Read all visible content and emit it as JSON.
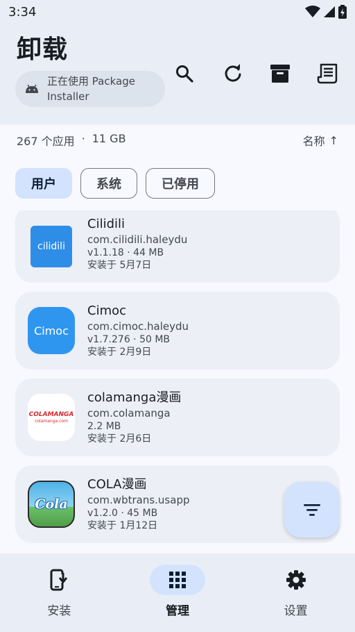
{
  "status_bar": {
    "time": "3:34"
  },
  "header": {
    "title": "卸载",
    "installer_chip": "正在使用 Package Installer"
  },
  "toolbar": {
    "icons": [
      "search-icon",
      "refresh-icon",
      "archive-icon",
      "log-icon"
    ]
  },
  "summary": {
    "app_count": "267 个应用",
    "separator": "·",
    "total_size": "11 GB",
    "sort_label": "名称",
    "sort_arrow": "↑"
  },
  "filters": [
    {
      "label": "用户",
      "selected": true
    },
    {
      "label": "系统",
      "selected": false
    },
    {
      "label": "已停用",
      "selected": false
    }
  ],
  "apps": [
    {
      "name": "Cilidili",
      "package": "com.cilidili.haleydu",
      "version_size": "v1.1.18 · 44 MB",
      "installed": "安装于 5月7日",
      "icon_text": "cilidili",
      "icon_color": "#2e8de6"
    },
    {
      "name": "Cimoc",
      "package": "com.cimoc.haleydu",
      "version_size": "v1.7.276 · 50 MB",
      "installed": "安装于 2月9日",
      "icon_text": "Cimoc",
      "icon_color": "#2f96ef"
    },
    {
      "name": "colamanga漫画",
      "package": "com.colamanga",
      "version_size": "2.2 MB",
      "installed": "安装于 2月6日",
      "icon_text": "COLAMANGA",
      "icon_subtext": "colamanga.com",
      "icon_color": "#ffffff"
    },
    {
      "name": "COLA漫画",
      "package": "com.wbtrans.usapp",
      "version_size": "v1.2.0 · 45 MB",
      "installed": "安装于 1月12日",
      "icon_text": "Cola",
      "icon_color": "#4fb2e8"
    }
  ],
  "bottom_nav": [
    {
      "label": "安装",
      "icon": "install-icon",
      "active": false
    },
    {
      "label": "管理",
      "icon": "grid-icon",
      "active": true
    },
    {
      "label": "设置",
      "icon": "gear-icon",
      "active": false
    }
  ],
  "colors": {
    "accent_container": "#d3e3fd",
    "surface": "#e9eef6",
    "card": "#eceff6"
  }
}
